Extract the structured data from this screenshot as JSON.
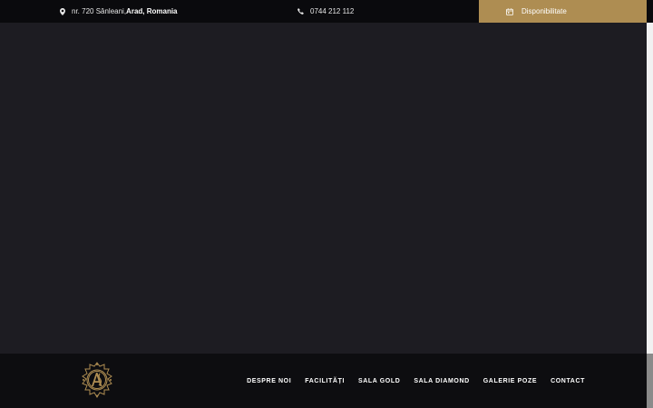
{
  "topbar": {
    "address_prefix": "nr. 720 Sânleani, ",
    "address_bold": "Arad, Romania",
    "phone": "0744 212 112",
    "availability_label": "Disponibilitate"
  },
  "nav": {
    "items": [
      {
        "label": "DESPRE NOI"
      },
      {
        "label": "FACILITĂȚI"
      },
      {
        "label": "SALA GOLD"
      },
      {
        "label": "SALA DIAMOND"
      },
      {
        "label": "GALERIE POZE"
      },
      {
        "label": "CONTACT"
      }
    ]
  },
  "colors": {
    "accent": "#ae8d52",
    "topbar_bg": "#0a0a0d",
    "hero_bg": "#1d1c22",
    "nav_bg": "#0d0d10"
  }
}
